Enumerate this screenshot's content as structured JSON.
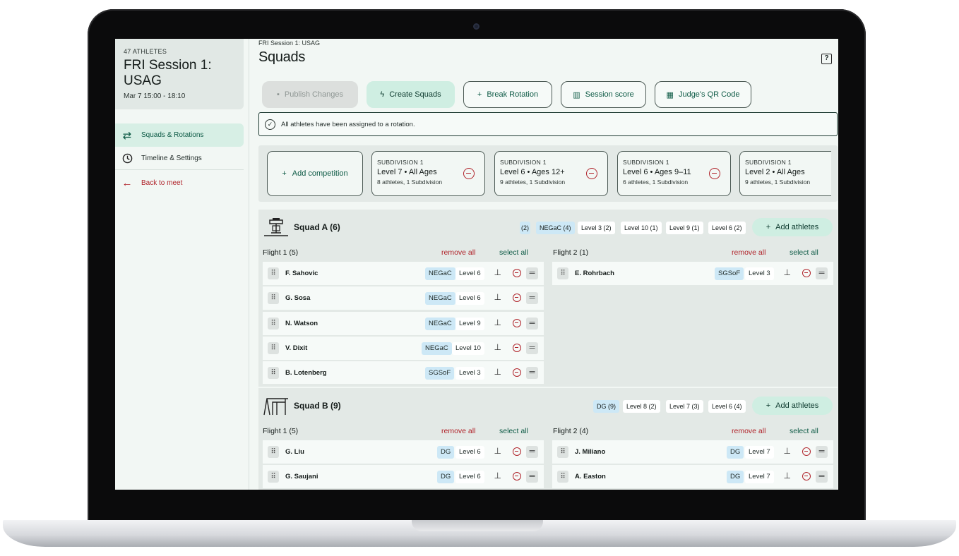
{
  "session": {
    "athletes": "47 ATHLETES",
    "title": "FRI Session 1: USAG",
    "time": "Mar 7 15:00 - 18:10"
  },
  "nav": [
    {
      "label": "Squads & Rotations",
      "icon": "swap-arrows-icon"
    },
    {
      "label": "Timeline & Settings",
      "icon": "clock-icon"
    },
    {
      "label": "Back to meet",
      "icon": "arrow-left-icon"
    }
  ],
  "header": {
    "breadcrumb": "FRI Session 1: USAG",
    "title": "Squads",
    "help_icon": "help-icon"
  },
  "toolbar": {
    "publish": "Publish Changes",
    "create": "Create Squads",
    "break": "Break Rotation",
    "score": "Session score",
    "qr": "Judge's QR Code"
  },
  "alert": "All athletes have been assigned to a rotation.",
  "competitions": {
    "add": "Add competition",
    "items": [
      {
        "sub": "SUBDIVISION 1",
        "level": "Level 7 • All Ages",
        "info": "8 athletes, 1 Subdivision"
      },
      {
        "sub": "SUBDIVISION 1",
        "level": "Level 6 • Ages 12+",
        "info": "9 athletes, 1 Subdivision"
      },
      {
        "sub": "SUBDIVISION 1",
        "level": "Level 6 • Ages 9–11",
        "info": "6 athletes, 1 Subdivision"
      },
      {
        "sub": "SUBDIVISION 1",
        "level": "Level 2 • All Ages",
        "info": "9 athletes, 1 Subdivision"
      }
    ]
  },
  "squads": [
    {
      "name": "Squad A (6)",
      "chips": [
        "(2)",
        "NEGaC (4)",
        "Level 3 (2)",
        "Level 10 (1)",
        "Level 9 (1)",
        "Level 6 (2)"
      ],
      "add": "Add athletes",
      "flights": [
        {
          "title": "Flight 1 (5)",
          "remove": "remove all",
          "select": "select all",
          "rows": [
            {
              "name": "F. Sahovic",
              "club": "NEGaC",
              "level": "Level 6"
            },
            {
              "name": "G. Sosa",
              "club": "NEGaC",
              "level": "Level 6"
            },
            {
              "name": "N. Watson",
              "club": "NEGaC",
              "level": "Level 9"
            },
            {
              "name": "V. Dixit",
              "club": "NEGaC",
              "level": "Level 10"
            },
            {
              "name": "B. Lotenberg",
              "club": "SGSoF",
              "level": "Level 3"
            }
          ]
        },
        {
          "title": "Flight 2 (1)",
          "remove": "remove all",
          "select": "select all",
          "rows": [
            {
              "name": "E. Rohrbach",
              "club": "SGSoF",
              "level": "Level 3"
            }
          ]
        }
      ]
    },
    {
      "name": "Squad B (9)",
      "chips": [
        "DG (9)",
        "Level 8 (2)",
        "Level 7 (3)",
        "Level 6 (4)"
      ],
      "add": "Add athletes",
      "flights": [
        {
          "title": "Flight 1 (5)",
          "remove": "remove all",
          "select": "select all",
          "rows": [
            {
              "name": "G. Liu",
              "club": "DG",
              "level": "Level 6"
            },
            {
              "name": "G. Saujani",
              "club": "DG",
              "level": "Level 6"
            }
          ]
        },
        {
          "title": "Flight 2 (4)",
          "remove": "remove all",
          "select": "select all",
          "rows": [
            {
              "name": "J. Miliano",
              "club": "DG",
              "level": "Level 7"
            },
            {
              "name": "A. Easton",
              "club": "DG",
              "level": "Level 7"
            }
          ]
        }
      ]
    }
  ]
}
